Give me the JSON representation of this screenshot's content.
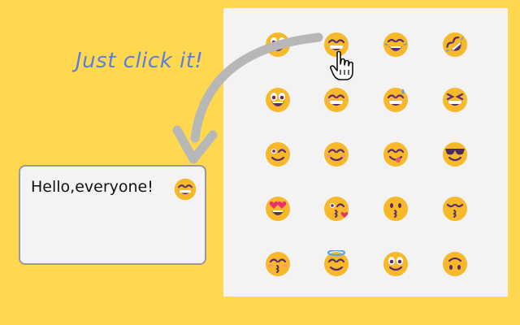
{
  "caption": "Just click it!",
  "textbox": {
    "text": "Hello,everyone!",
    "inserted_emoji": "grinning-face-with-smiling-eyes"
  },
  "colors": {
    "background": "#ffd84f",
    "panel": "#f3f3f3",
    "caption": "#5a7ee0",
    "arrow": "#b7b7b7",
    "emoji_face": "#f7b829"
  },
  "emoji_grid": {
    "rows": [
      [
        "grinning-face-big-eyes",
        "grinning-face-with-smiling-eyes",
        "face-with-tears-of-joy",
        "rolling-on-floor-laughing"
      ],
      [
        "smiley-face",
        "beaming-face",
        "grinning-face-with-sweat",
        "squinting-face-with-tongue-closed"
      ],
      [
        "winking-face",
        "smiling-face-with-smiling-eyes",
        "face-savoring-food",
        "smiling-face-with-sunglasses"
      ],
      [
        "smiling-face-with-heart-eyes",
        "face-blowing-a-kiss",
        "kissing-face",
        "kissing-face-closed-eyes"
      ],
      [
        "kissing-face-with-smiling-eyes",
        "smiling-face-with-halo",
        "slightly-smiling-face",
        "upside-down-face"
      ]
    ]
  },
  "pointer": "hand-pointer-cursor-icon"
}
